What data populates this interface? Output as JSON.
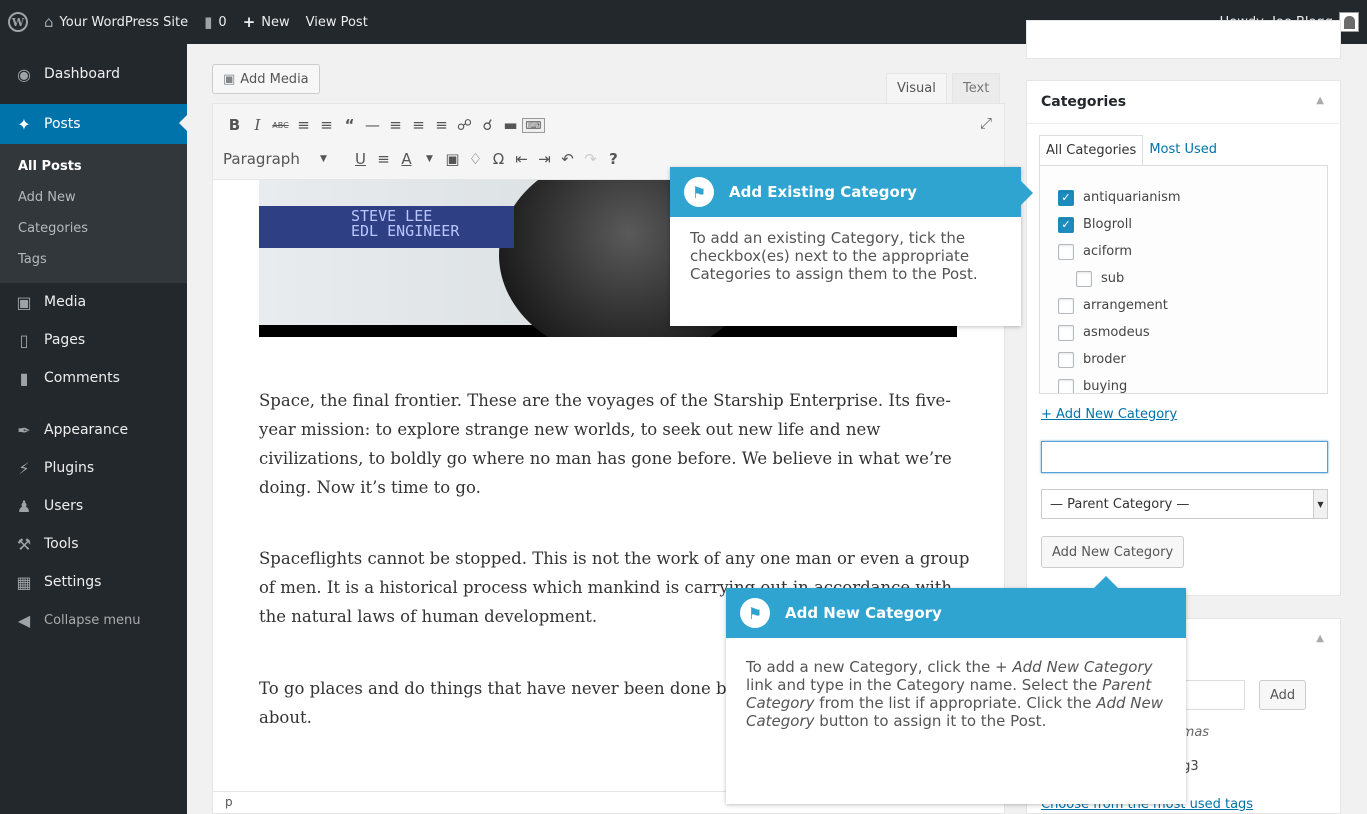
{
  "admin_bar": {
    "wp_logo_icon": "wordpress-logo-icon",
    "site_name": "Your WordPress Site",
    "comments_count": "0",
    "new_label": "New",
    "view_post": "View Post",
    "howdy": "Howdy, Joe Blogg"
  },
  "menu": {
    "dashboard": "Dashboard",
    "posts": "Posts",
    "posts_sub": [
      "All Posts",
      "Add New",
      "Categories",
      "Tags"
    ],
    "media": "Media",
    "pages": "Pages",
    "comments": "Comments",
    "appearance": "Appearance",
    "plugins": "Plugins",
    "users": "Users",
    "tools": "Tools",
    "settings": "Settings",
    "collapse": "Collapse menu"
  },
  "editor": {
    "add_media": "Add Media",
    "tab_visual": "Visual",
    "tab_text": "Text",
    "format_select": "Paragraph",
    "image_text_line1": "STEVE LEE",
    "image_text_line2": "EDL ENGINEER",
    "paragraphs": [
      "Space, the final frontier. These are the voyages of the Starship Enterprise. Its five-year mission: to explore strange new worlds, to seek out new life and new civilizations, to boldly go where no man has gone before. We believe in what we’re doing. Now it’s time to go.",
      "Spaceflights cannot be stopped. This is not the work of any one man or even a group of men. It is a historical process which mankind is carrying out in accordance with the natural laws of human development.",
      "To go places and do things that have never been done before – that’s what living is all about."
    ],
    "status_path": "p"
  },
  "categories_box": {
    "title": "Categories",
    "tab_all": "All Categories",
    "tab_most_used": "Most Used",
    "items": [
      {
        "label": "antiquarianism",
        "checked": true
      },
      {
        "label": "Blogroll",
        "checked": true
      },
      {
        "label": "aciform",
        "checked": false
      },
      {
        "label": "sub",
        "checked": false
      },
      {
        "label": "arrangement",
        "checked": false
      },
      {
        "label": "asmodeus",
        "checked": false
      },
      {
        "label": "broder",
        "checked": false
      },
      {
        "label": "buying",
        "checked": false
      }
    ],
    "add_new_link": "+ Add New Category",
    "new_category_value": "",
    "parent_select": "— Parent Category —",
    "add_button": "Add New Category"
  },
  "tags_box": {
    "add_button": "Add",
    "separator_hint": "mmas",
    "tag_item": "tag3",
    "choose_link": "Choose from the most used tags"
  },
  "callouts": {
    "existing": {
      "title": "Add Existing Category",
      "body": "To add an existing Category, tick the checkbox(es) next to the appropriate Categories to assign them to the Post."
    },
    "new": {
      "title": "Add New Category",
      "body_1": "To add a new Category, click the ",
      "body_em1": "+ Add New Category",
      "body_2": " link and type in the Category name. Select the ",
      "body_em2": "Parent Category",
      "body_3": " from the list if appropriate. Click the ",
      "body_em3": "Add New Category",
      "body_4": " button to assign it to the Post."
    }
  },
  "colors": {
    "admin_dark": "#23282d",
    "accent_blue": "#0073aa",
    "callout_blue": "#2fa4d0",
    "checkbox_blue": "#1e8cbe"
  }
}
